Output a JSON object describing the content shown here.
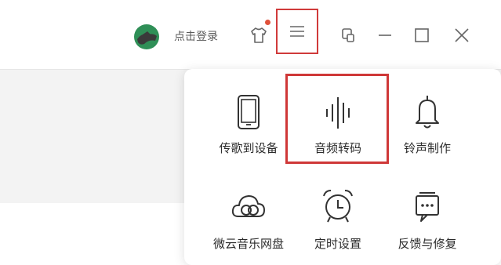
{
  "titlebar": {
    "login_label": "点击登录",
    "icons": [
      "avatar-icon",
      "skin-shirt-icon",
      "menu-icon",
      "mini-mode-icon",
      "minimize-icon",
      "maximize-icon",
      "close-icon"
    ],
    "notification_dot_color": "#e0513a"
  },
  "menu": {
    "items": [
      {
        "label": "传歌到设备",
        "icon": "phone-icon"
      },
      {
        "label": "音频转码",
        "icon": "waveform-icon"
      },
      {
        "label": "铃声制作",
        "icon": "bell-icon"
      },
      {
        "label": "微云音乐网盘",
        "icon": "cloud-icon"
      },
      {
        "label": "定时设置",
        "icon": "alarm-clock-icon"
      },
      {
        "label": "反馈与修复",
        "icon": "feedback-icon"
      }
    ]
  },
  "highlight_color": "#cf3838"
}
